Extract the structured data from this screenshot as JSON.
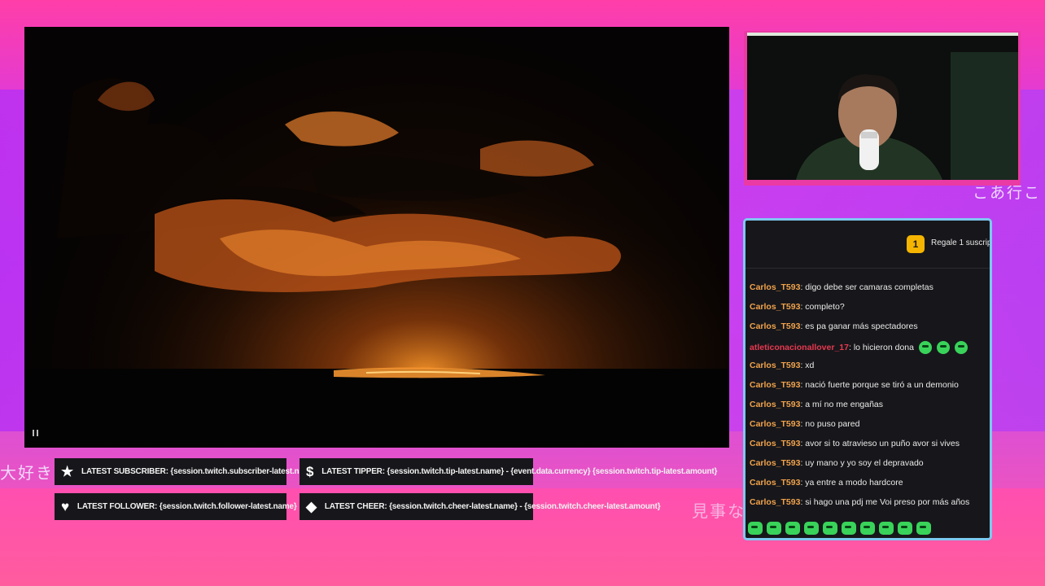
{
  "decor": {
    "jp_left": "大好き",
    "jp_right": "こあ行こ",
    "jp_bottom": "見事な"
  },
  "chat": {
    "gift_count": "1",
    "gift_text": "Regale 1 suscrip",
    "messages": [
      {
        "user": "Carlos_T593",
        "text": "digo debe ser camaras completas"
      },
      {
        "user": "Carlos_T593",
        "text": "completo?"
      },
      {
        "user": "Carlos_T593",
        "text": "es pa ganar más spectadores"
      },
      {
        "user": "atleticonacionallover_17",
        "text": "lo hicieron dona"
      },
      {
        "user": "Carlos_T593",
        "text": "xd"
      },
      {
        "user": "Carlos_T593",
        "text": "nació fuerte porque se tiró a un demonio"
      },
      {
        "user": "Carlos_T593",
        "text": "a mí no me engañas"
      },
      {
        "user": "Carlos_T593",
        "text": "no puso pared"
      },
      {
        "user": "Carlos_T593",
        "text": "avor si to atravieso un puño avor si vives"
      },
      {
        "user": "Carlos_T593",
        "text": "uy mano y yo soy el depravado"
      },
      {
        "user": "Carlos_T593",
        "text": "ya entre a modo hardcore"
      },
      {
        "user": "Carlos_T593",
        "text": "si hago una pdj me Voi preso por más años"
      }
    ],
    "emote_color": "#39d35a"
  },
  "tickers": {
    "subscriber": "LATEST SUBSCRIBER: {session.twitch.subscriber-latest.name}",
    "tipper": "LATEST TIPPER: {session.twitch.tip-latest.name} - {event.data.currency} {session.twitch.tip-latest.amount}",
    "follower": "LATEST FOLLOWER: {session.twitch.follower-latest.name}",
    "cheer": "LATEST CHEER: {session.twitch.cheer-latest.name} - {session.twitch.cheer-latest.amount}"
  },
  "icons": {
    "subscriber": "star-icon",
    "tipper": "dollar-icon",
    "follower": "heart-icon",
    "cheer": "diamond-icon"
  }
}
